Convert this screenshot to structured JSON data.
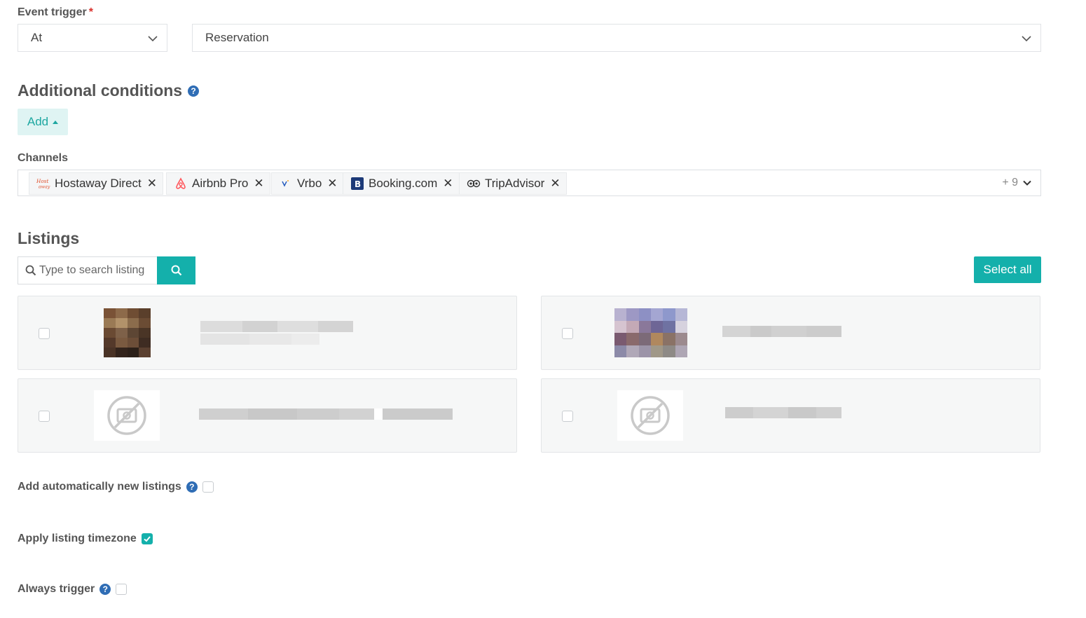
{
  "event_trigger": {
    "label": "Event trigger",
    "required_mark": "*",
    "timing_value": "At",
    "event_value": "Reservation"
  },
  "additional_conditions": {
    "title": "Additional conditions",
    "add_button": "Add"
  },
  "channels": {
    "label": "Channels",
    "chips": [
      {
        "label": "Hostaway Direct",
        "icon": "hostaway-logo-icon"
      },
      {
        "label": "Airbnb Pro",
        "icon": "airbnb-logo-icon"
      },
      {
        "label": "Vrbo",
        "icon": "vrbo-logo-icon"
      },
      {
        "label": "Booking.com",
        "icon": "booking-logo-icon"
      },
      {
        "label": "TripAdvisor",
        "icon": "tripadvisor-logo-icon"
      }
    ],
    "more_count": "+ 9"
  },
  "listings": {
    "title": "Listings",
    "search_placeholder": "Type to search listing",
    "select_all": "Select all"
  },
  "options": {
    "auto_add_label": "Add automatically new listings",
    "timezone_label": "Apply listing timezone",
    "always_trigger_label": "Always trigger"
  },
  "colors": {
    "accent": "#14b0ab",
    "help": "#2f6db5",
    "required": "#d9302b"
  }
}
